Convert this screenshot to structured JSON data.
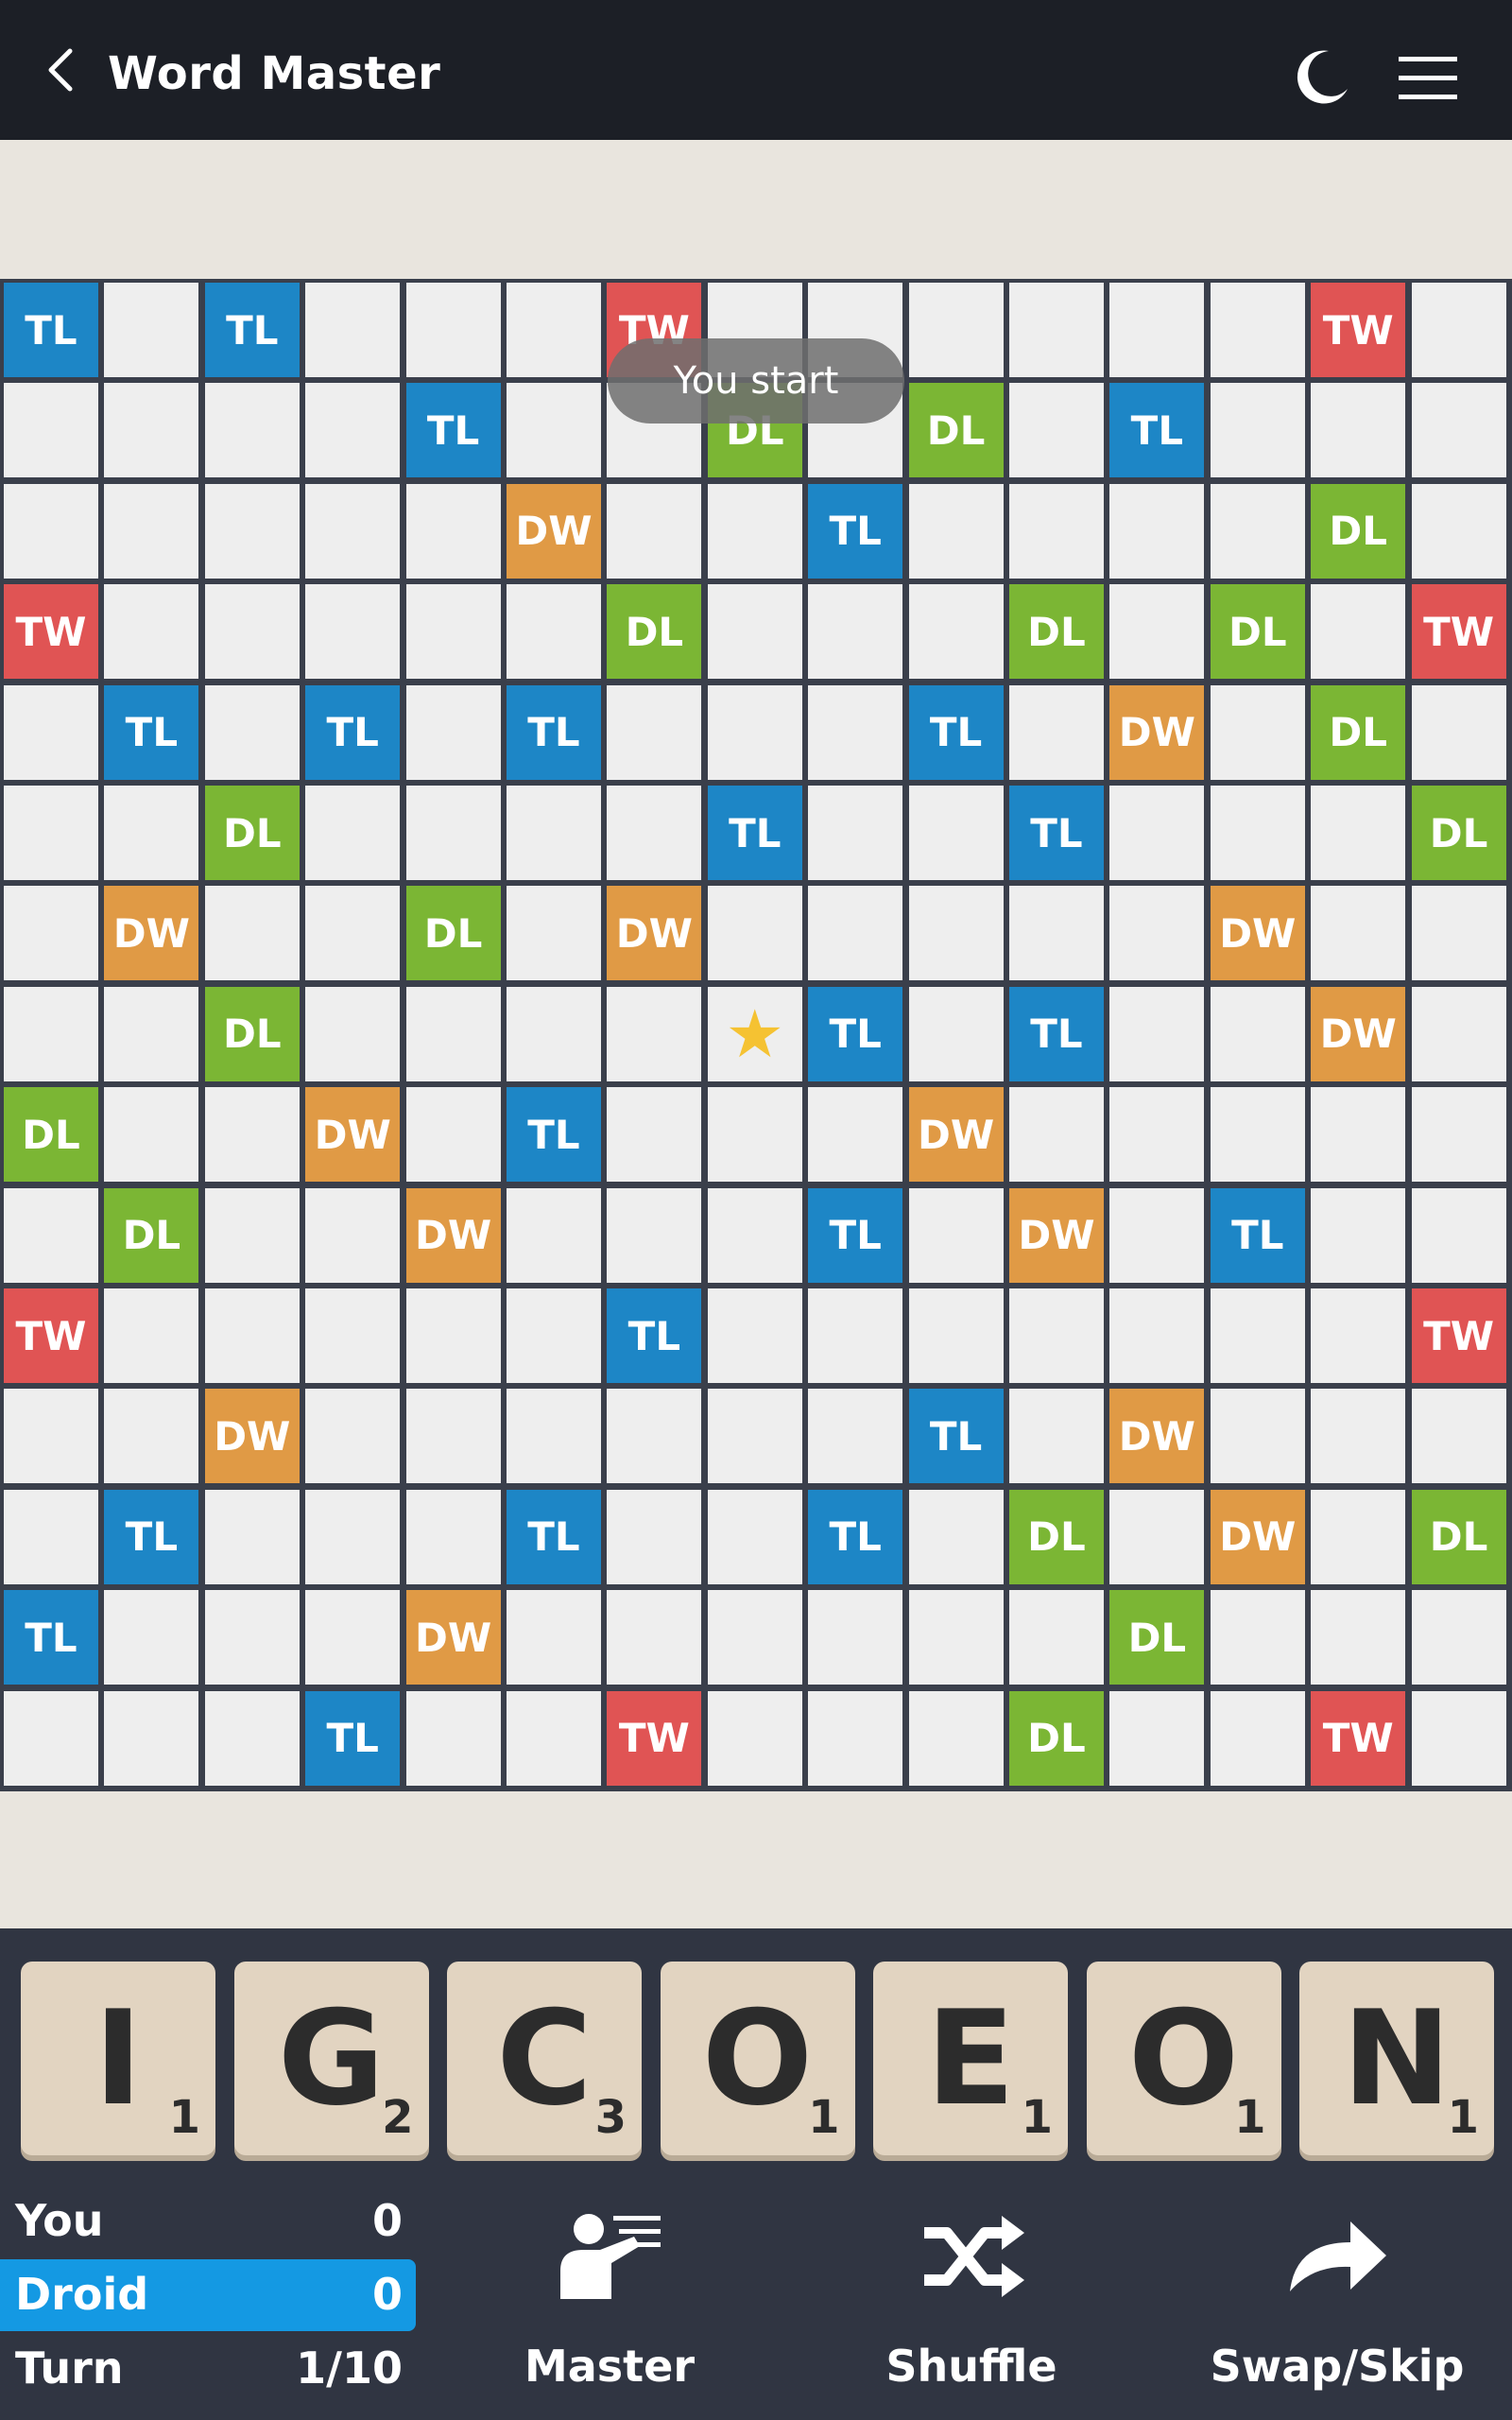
{
  "header": {
    "title": "Word Master",
    "back_icon": "chevron-left-icon",
    "night_icon": "moon-icon",
    "menu_icon": "hamburger-menu-icon"
  },
  "toast": "You start",
  "board": {
    "size": 15,
    "labels": {
      "TL": "TL",
      "DL": "DL",
      "DW": "DW",
      "TW": "TW"
    },
    "colors": {
      "TL": "#1d86c6",
      "DL": "#7bb634",
      "DW": "#e09a45",
      "TW": "#e05454",
      "empty": "#eeeeee"
    },
    "rows": [
      [
        "TL",
        "",
        "TL",
        "",
        "",
        "",
        "TW",
        "",
        "",
        "",
        "",
        "",
        "",
        "TW",
        ""
      ],
      [
        "",
        "",
        "",
        "",
        "TL",
        "",
        "",
        "DL",
        "",
        "DL",
        "",
        "TL",
        "",
        "",
        ""
      ],
      [
        "",
        "",
        "",
        "",
        "",
        "DW",
        "",
        "",
        "TL",
        "",
        "",
        "",
        "",
        "DL",
        ""
      ],
      [
        "TW",
        "",
        "",
        "",
        "",
        "",
        "DL",
        "",
        "",
        "",
        "DL",
        "",
        "DL",
        "",
        "TW"
      ],
      [
        "",
        "TL",
        "",
        "TL",
        "",
        "TL",
        "",
        "",
        "",
        "TL",
        "",
        "DW",
        "",
        "DL",
        ""
      ],
      [
        "",
        "",
        "DL",
        "",
        "",
        "",
        "",
        "TL",
        "",
        "",
        "TL",
        "",
        "",
        "",
        "DL"
      ],
      [
        "",
        "DW",
        "",
        "",
        "DL",
        "",
        "DW",
        "",
        "",
        "",
        "",
        "",
        "DW",
        "",
        ""
      ],
      [
        "",
        "",
        "DL",
        "",
        "",
        "",
        "",
        "★",
        "TL",
        "",
        "TL",
        "",
        "",
        "DW",
        ""
      ],
      [
        "DL",
        "",
        "",
        "DW",
        "",
        "TL",
        "",
        "",
        "",
        "DW",
        "",
        "",
        "",
        "",
        ""
      ],
      [
        "",
        "DL",
        "",
        "",
        "DW",
        "",
        "",
        "",
        "TL",
        "",
        "DW",
        "",
        "TL",
        "",
        ""
      ],
      [
        "TW",
        "",
        "",
        "",
        "",
        "",
        "TL",
        "",
        "",
        "",
        "",
        "",
        "",
        "",
        "TW"
      ],
      [
        "",
        "",
        "DW",
        "",
        "",
        "",
        "",
        "",
        "",
        "TL",
        "",
        "DW",
        "",
        "",
        ""
      ],
      [
        "",
        "TL",
        "",
        "",
        "",
        "TL",
        "",
        "",
        "TL",
        "",
        "DL",
        "",
        "DW",
        "",
        "DL"
      ],
      [
        "TL",
        "",
        "",
        "",
        "DW",
        "",
        "",
        "",
        "",
        "",
        "",
        "DL",
        "",
        "",
        ""
      ],
      [
        "",
        "",
        "",
        "TL",
        "",
        "",
        "TW",
        "",
        "",
        "",
        "DL",
        "",
        "",
        "TW",
        ""
      ]
    ]
  },
  "rack": [
    {
      "letter": "I",
      "points": "1"
    },
    {
      "letter": "G",
      "points": "2"
    },
    {
      "letter": "C",
      "points": "3"
    },
    {
      "letter": "O",
      "points": "1"
    },
    {
      "letter": "E",
      "points": "1"
    },
    {
      "letter": "O",
      "points": "1"
    },
    {
      "letter": "N",
      "points": "1"
    }
  ],
  "scores": {
    "you": {
      "name": "You",
      "value": "0"
    },
    "droid": {
      "name": "Droid",
      "value": "0"
    },
    "turn": {
      "name": "Turn",
      "value": "1/10"
    }
  },
  "actions": {
    "master": {
      "label": "Master",
      "icon": "teacher-icon"
    },
    "shuffle": {
      "label": "Shuffle",
      "icon": "shuffle-icon"
    },
    "swap": {
      "label": "Swap/Skip",
      "icon": "share-arrow-icon"
    }
  }
}
